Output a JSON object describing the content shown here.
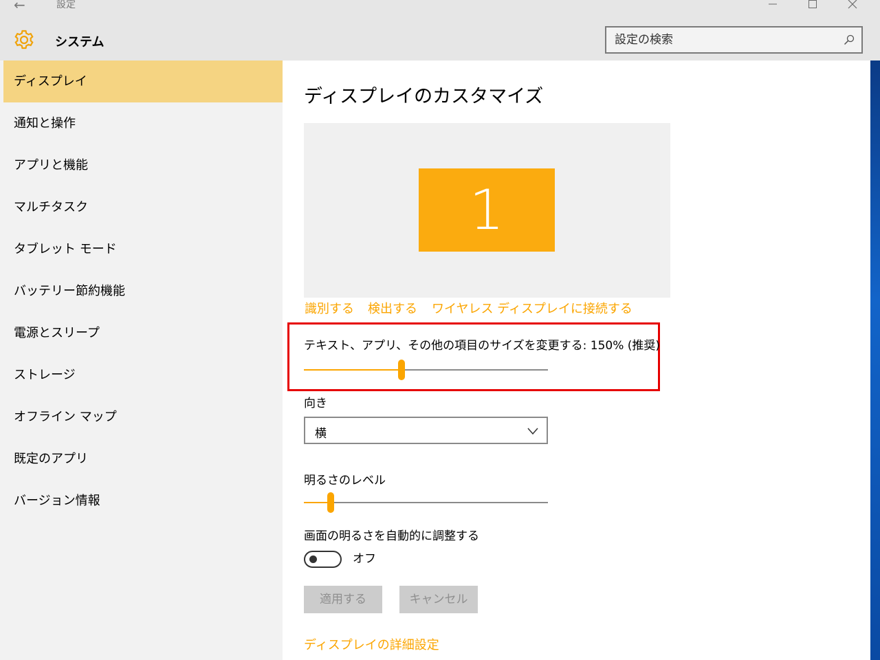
{
  "window": {
    "title": "設定",
    "back_glyph": "←"
  },
  "header": {
    "app_title": "システム"
  },
  "search": {
    "placeholder": "設定の検索"
  },
  "sidebar": {
    "items": [
      {
        "label": "ディスプレイ",
        "active": true
      },
      {
        "label": "通知と操作"
      },
      {
        "label": "アプリと機能"
      },
      {
        "label": "マルチタスク"
      },
      {
        "label": "タブレット モード"
      },
      {
        "label": "バッテリー節約機能"
      },
      {
        "label": "電源とスリープ"
      },
      {
        "label": "ストレージ"
      },
      {
        "label": "オフライン マップ"
      },
      {
        "label": "既定のアプリ"
      },
      {
        "label": "バージョン情報"
      }
    ]
  },
  "main": {
    "title": "ディスプレイのカスタマイズ",
    "monitor_number": "1",
    "links": {
      "identify": "識別する",
      "detect": "検出する",
      "wireless": "ワイヤレス ディスプレイに接続する"
    },
    "scale": {
      "label": "テキスト、アプリ、その他の項目のサイズを変更する: 150% (推奨)",
      "fraction": 0.4
    },
    "orientation": {
      "label": "向き",
      "value": "横"
    },
    "brightness": {
      "label": "明るさのレベル",
      "fraction": 0.11
    },
    "auto_brightness": {
      "label": "画面の明るさを自動的に調整する",
      "state": "オフ"
    },
    "buttons": {
      "apply": "適用する",
      "cancel": "キャンセル"
    },
    "advanced_link": "ディスプレイの詳細設定"
  },
  "colors": {
    "accent": "#fba500",
    "active_item": "#f5d482",
    "tile": "#fbab0f",
    "highlight": "#e60000"
  }
}
